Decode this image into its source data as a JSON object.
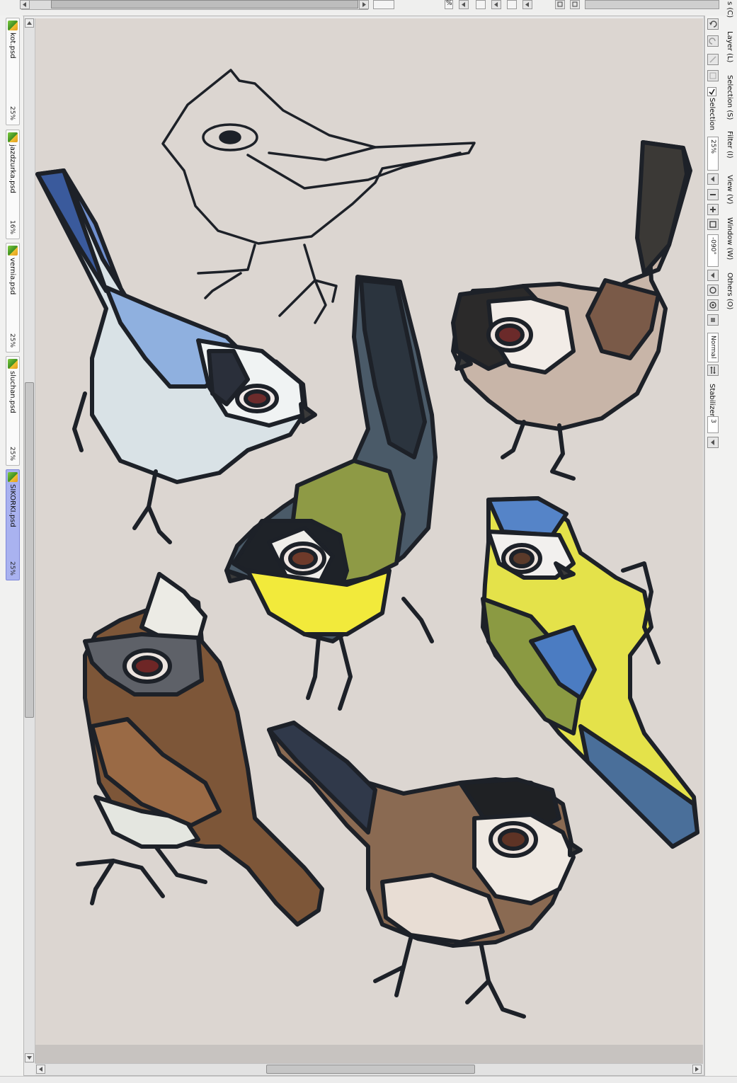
{
  "top_toolbar": {
    "percent_label": "%"
  },
  "open_files": [
    {
      "name": "kot.psd",
      "zoom": "25%",
      "active": false
    },
    {
      "name": "jazdzurka.psd",
      "zoom": "16%",
      "active": false
    },
    {
      "name": "vernia.psd",
      "zoom": "25%",
      "active": false
    },
    {
      "name": "sluchan.psd",
      "zoom": "25%",
      "active": false
    },
    {
      "name": "SIKORKI.psd",
      "zoom": "25%",
      "active": true
    }
  ],
  "command_bar": {
    "menus": [
      {
        "label": "Layer (L)"
      },
      {
        "label": "Selection (S)"
      },
      {
        "label": "Filter (I)"
      },
      {
        "label": "View (V)"
      },
      {
        "label": "Window (W)"
      },
      {
        "label": "Others (O)"
      }
    ],
    "top_partial_label": "s (C)",
    "selection_checkbox_label": "Selection",
    "zoom_value": "25%",
    "rotation_value": "-090°",
    "blend_mode": "Normal",
    "stabilizer_label": "Stabilizer",
    "stabilizer_value": "3"
  },
  "colors": {
    "artboard": "#dcd6d1",
    "active_tab": "#a9b2f0",
    "outline": "#1d2128"
  },
  "icons": {
    "undo": "undo-icon",
    "redo": "redo-icon",
    "zoom_out": "zoom-out-icon",
    "zoom_in": "zoom-in-icon",
    "fit": "fit-window-icon",
    "rotate_left": "rotate-left-icon",
    "rotate_right": "rotate-right-icon",
    "reset_rotation": "reset-rotation-icon",
    "flip": "flip-horizontal-icon"
  }
}
